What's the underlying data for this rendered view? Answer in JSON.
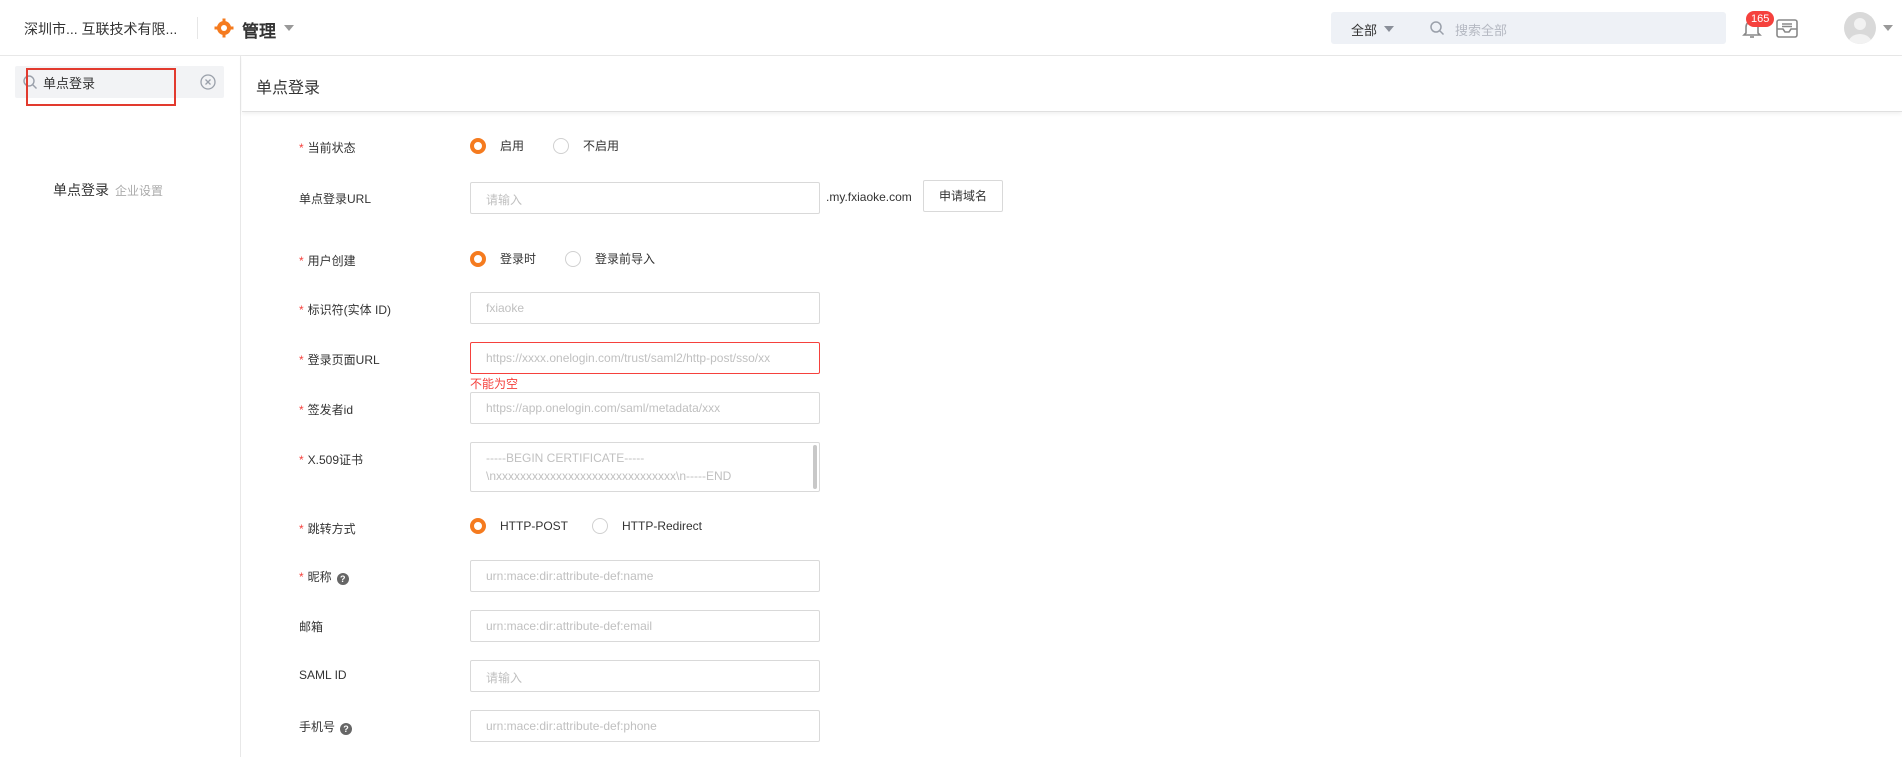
{
  "topbar": {
    "company_name": "深圳市... 互联技术有限...",
    "module_title": "管理",
    "search_scope": "全部",
    "search_placeholder": "搜索全部",
    "notification_count": "165"
  },
  "sidebar": {
    "search_value": "单点登录",
    "result_title": "单点登录",
    "result_category": "企业设置"
  },
  "main": {
    "page_title": "单点登录",
    "form": {
      "status": {
        "label": "当前状态",
        "required": "*",
        "options": [
          "启用",
          "不启用"
        ],
        "selected": "启用"
      },
      "sso_url": {
        "label": "单点登录URL",
        "placeholder": "请输入",
        "suffix": ".my.fxiaoke.com",
        "button": "申请域名"
      },
      "user_create": {
        "label": "用户创建",
        "required": "*",
        "options": [
          "登录时",
          "登录前导入"
        ],
        "selected": "登录时"
      },
      "entity_id": {
        "label": "标识符(实体 ID)",
        "required": "*",
        "placeholder": "fxiaoke"
      },
      "login_url": {
        "label": "登录页面URL",
        "required": "*",
        "placeholder": "https://xxxx.onelogin.com/trust/saml2/http-post/sso/xx",
        "error": "不能为空"
      },
      "issuer_id": {
        "label": "签发者id",
        "required": "*",
        "placeholder": "https://app.onelogin.com/saml/metadata/xxx"
      },
      "certificate": {
        "label": "X.509证书",
        "required": "*",
        "placeholder": "-----BEGIN CERTIFICATE-----\\nxxxxxxxxxxxxxxxxxxxxxxxxxxxxxx\\n-----END"
      },
      "redirect": {
        "label": "跳转方式",
        "required": "*",
        "options": [
          "HTTP-POST",
          "HTTP-Redirect"
        ],
        "selected": "HTTP-POST"
      },
      "nickname": {
        "label": "昵称",
        "required": "*",
        "placeholder": "urn:mace:dir:attribute-def:name"
      },
      "email": {
        "label": "邮箱",
        "placeholder": "urn:mace:dir:attribute-def:email"
      },
      "saml_id": {
        "label": "SAML ID",
        "placeholder": "请输入"
      },
      "phone": {
        "label": "手机号",
        "placeholder": "urn:mace:dir:attribute-def:phone"
      }
    }
  },
  "colors": {
    "accent": "#f57b1f",
    "error": "#f5413d",
    "badge": "#f5413d"
  }
}
